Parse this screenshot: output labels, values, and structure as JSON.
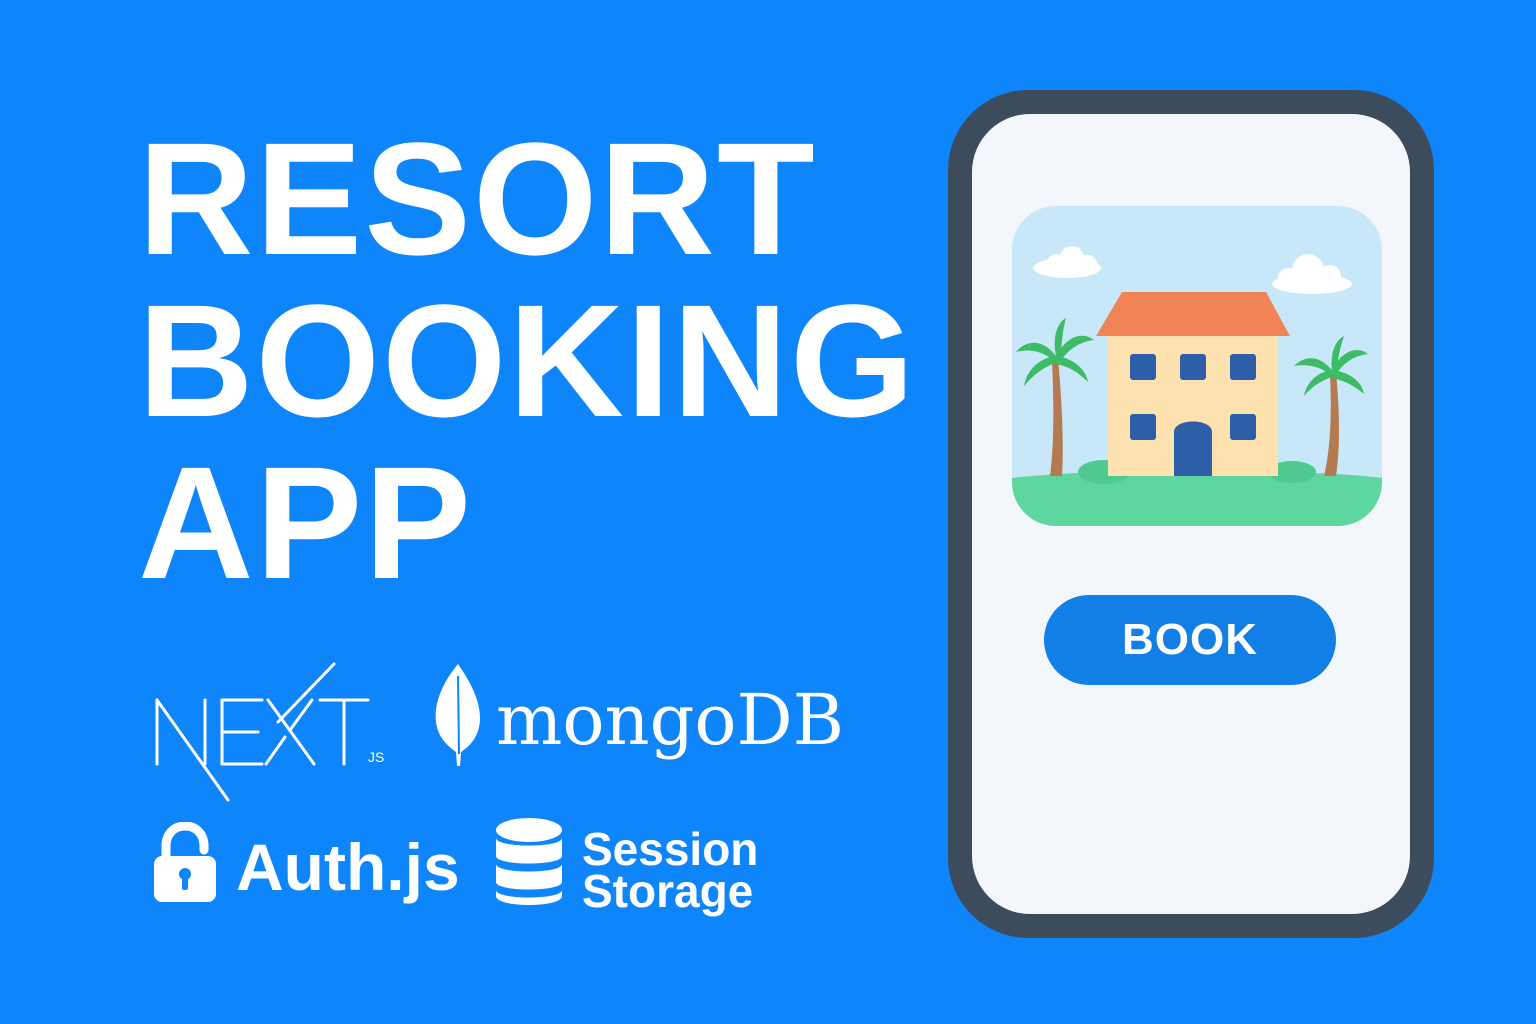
{
  "title": {
    "line1": "RESORT",
    "line2": "BOOKING",
    "line3": "APP"
  },
  "tech_logos": {
    "nextjs": {
      "wordmark": "NEXT",
      "suffix": "JS",
      "icon": "nextjs-logo"
    },
    "mongodb": {
      "wordmark": "mongoDB",
      "icon": "mongodb-leaf-icon"
    },
    "authjs": {
      "label": "Auth.js",
      "icon": "padlock-icon"
    },
    "session_storage": {
      "line1": "Session",
      "line2": "Storage",
      "icon": "database-icon"
    }
  },
  "phone": {
    "image": "resort-illustration",
    "book_button_label": "BOOK"
  },
  "colors": {
    "background": "#0f85fb",
    "text": "#ffffff",
    "phone_frame": "#3d4c5c",
    "phone_screen": "#f3f6fb",
    "button": "#127fe7",
    "sky": "#c8e7f8",
    "grass": "#5dd69f",
    "roof": "#f08457",
    "building": "#fde2af",
    "windows": "#2d5fa8",
    "palm_leaves": "#3dbb66",
    "palm_trunk": "#b57b50"
  }
}
